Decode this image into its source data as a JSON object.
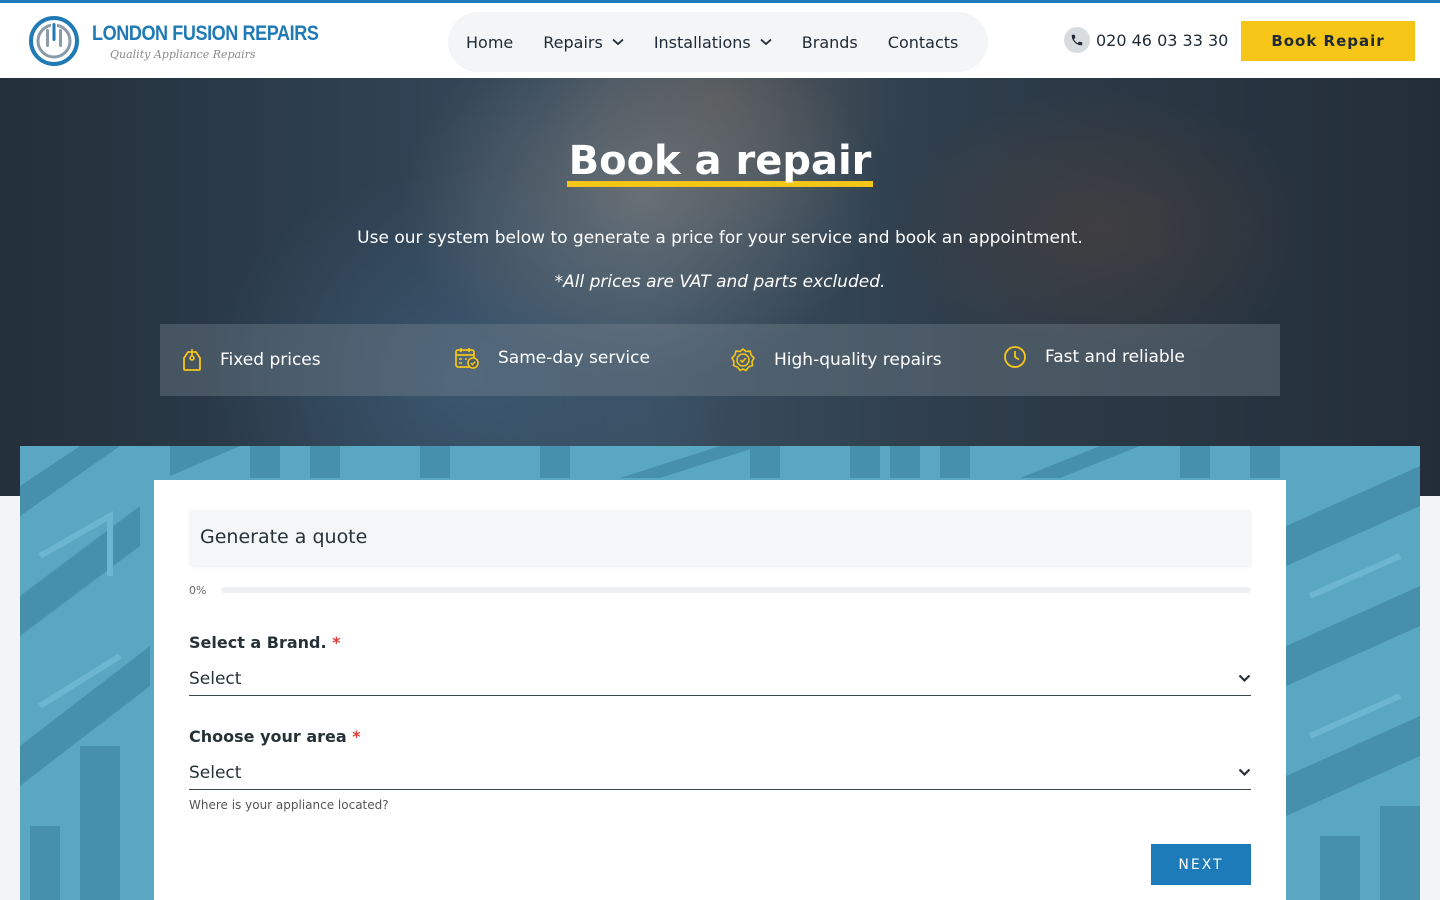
{
  "brand": {
    "name": "LONDON FUSION REPAIRS",
    "tagline": "Quality Appliance Repairs"
  },
  "nav": {
    "items": [
      {
        "label": "Home",
        "dropdown": false
      },
      {
        "label": "Repairs",
        "dropdown": true
      },
      {
        "label": "Installations",
        "dropdown": true
      },
      {
        "label": "Brands",
        "dropdown": false
      },
      {
        "label": "Contacts",
        "dropdown": false
      }
    ]
  },
  "contact": {
    "phone": "020 46 03 33 30",
    "book_label": "Book Repair"
  },
  "hero": {
    "title": "Book a repair",
    "subtitle": "Use our system below to generate a price for your service and book an appointment.",
    "note": "*All prices are VAT and parts excluded."
  },
  "features": [
    {
      "label": "Fixed prices",
      "icon": "price-tag-icon"
    },
    {
      "label": "Same-day service",
      "icon": "calendar-check-icon"
    },
    {
      "label": "High-quality repairs",
      "icon": "badge-check-icon"
    },
    {
      "label": "Fast and reliable",
      "icon": "clock-icon"
    }
  ],
  "form": {
    "heading": "Generate a quote",
    "progress_text": "0%",
    "progress_value": 0,
    "brand_field": {
      "label": "Select a Brand.",
      "required_mark": "*",
      "value": "Select"
    },
    "area_field": {
      "label": "Choose your area",
      "required_mark": "*",
      "value": "Select",
      "help": "Where is your appliance located?"
    },
    "next_label": "NEXT"
  },
  "colors": {
    "accent_yellow": "#f5c518",
    "primary_blue": "#1c7bb8",
    "pattern_blue": "#5aa7c4",
    "required_red": "#e03a3a"
  }
}
